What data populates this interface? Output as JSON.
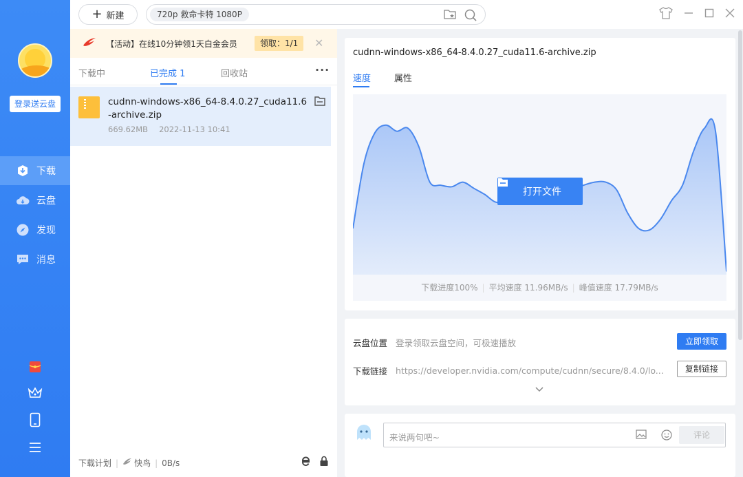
{
  "sidebar": {
    "login_label": "登录送云盘",
    "nav": [
      {
        "label": "下载",
        "icon": "download-icon",
        "active": true
      },
      {
        "label": "云盘",
        "icon": "cloud-icon",
        "active": false
      },
      {
        "label": "发现",
        "icon": "compass-icon",
        "active": false
      },
      {
        "label": "消息",
        "icon": "message-icon",
        "active": false
      }
    ],
    "bottom_icons": [
      "red-envelope-icon",
      "crown-icon",
      "phone-icon",
      "menu-icon"
    ]
  },
  "topbar": {
    "new_label": "新建",
    "search_tag": "720p  救命卡特 1080P"
  },
  "promo": {
    "text": "【活动】在线10分钟领1天白金会员",
    "claim_label": "领取：1/1"
  },
  "tabs": {
    "downloading": "下载中",
    "completed": "已完成",
    "completed_count": "1",
    "recycle": "回收站"
  },
  "file": {
    "name": "cudnn-windows-x86_64-8.4.0.27_cuda11.6-archive.zip",
    "size": "669.62MB",
    "date": "2022-11-13 10:41"
  },
  "left_footer": {
    "plan": "下载计划",
    "bird": "快鸟",
    "speed": "0B/s"
  },
  "detail": {
    "title": "cudnn-windows-x86_64-8.4.0.27_cuda11.6-archive.zip",
    "tab_speed": "速度",
    "tab_props": "属性",
    "open_label": "打开文件",
    "progress": "下载进度100%",
    "avg_speed": "平均速度 11.96MB/s",
    "peak_speed": "峰值速度 17.79MB/s"
  },
  "chart_data": {
    "type": "area",
    "values": [
      0.3,
      0.72,
      0.92,
      0.97,
      0.93,
      0.95,
      0.83,
      0.6,
      0.58,
      0.57,
      0.6,
      0.56,
      0.52,
      0.47,
      0.48,
      0.5,
      0.52,
      0.53,
      0.53,
      0.5,
      0.55,
      0.58,
      0.6,
      0.6,
      0.55,
      0.4,
      0.3,
      0.29,
      0.36,
      0.48,
      0.58,
      0.8,
      0.95,
      0.93,
      0.02
    ],
    "color": "#4a88ee"
  },
  "info": {
    "cloud_label": "云盘位置",
    "cloud_value": "登录领取云盘空间，可极速播放",
    "claim_now": "立即领取",
    "link_label": "下载链接",
    "link_value": "https://developer.nvidia.com/compute/cudnn/secure/8.4.0/lo...",
    "copy_link": "复制链接"
  },
  "comment": {
    "placeholder": "来说两句吧~",
    "send": "评论"
  }
}
